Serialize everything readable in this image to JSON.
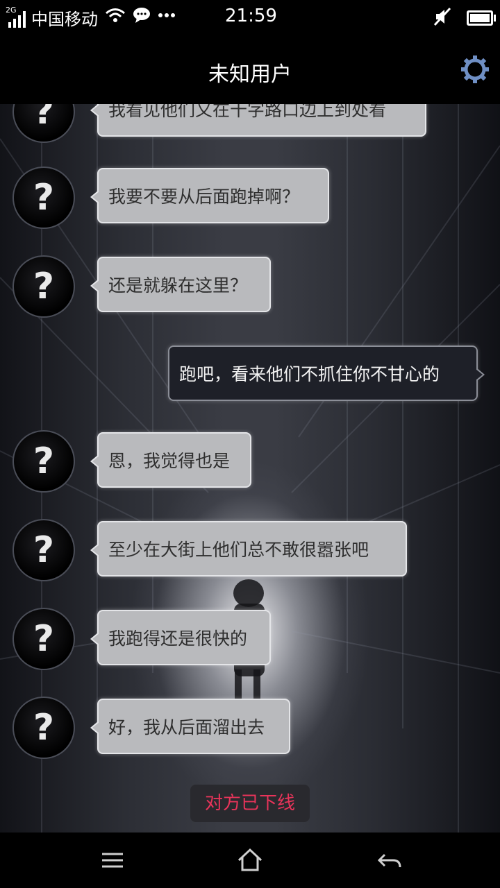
{
  "status_bar": {
    "network_type": "2G",
    "carrier": "中国移动",
    "time": "21:59",
    "icons": [
      "signal-icon",
      "wifi-icon",
      "message-icon",
      "more-icon",
      "mute-icon",
      "battery-icon"
    ],
    "battery_level": 1.0
  },
  "header": {
    "title": "未知用户",
    "settings_icon": "gear-icon"
  },
  "messages": [
    {
      "side": "in",
      "text": "我看见他们又在十字路口边上到处看"
    },
    {
      "side": "in",
      "text": "我要不要从后面跑掉啊？"
    },
    {
      "side": "in",
      "text": "还是就躲在这里？"
    },
    {
      "side": "out",
      "text": "跑吧，看来他们不抓住你不甘心的"
    },
    {
      "side": "in",
      "text": "恩，我觉得也是"
    },
    {
      "side": "in",
      "text": "至少在大街上他们总不敢很嚣张吧"
    },
    {
      "side": "in",
      "text": "我跑得还是很快的"
    },
    {
      "side": "in",
      "text": "好，我从后面溜出去"
    }
  ],
  "avatar_glyph": "?",
  "system_notice": "对方已下线",
  "nav_bar": {
    "icons": [
      "menu-icon",
      "home-icon",
      "back-icon"
    ]
  },
  "colors": {
    "notice_text": "#e8345a",
    "gear": "#6f8fc4"
  }
}
